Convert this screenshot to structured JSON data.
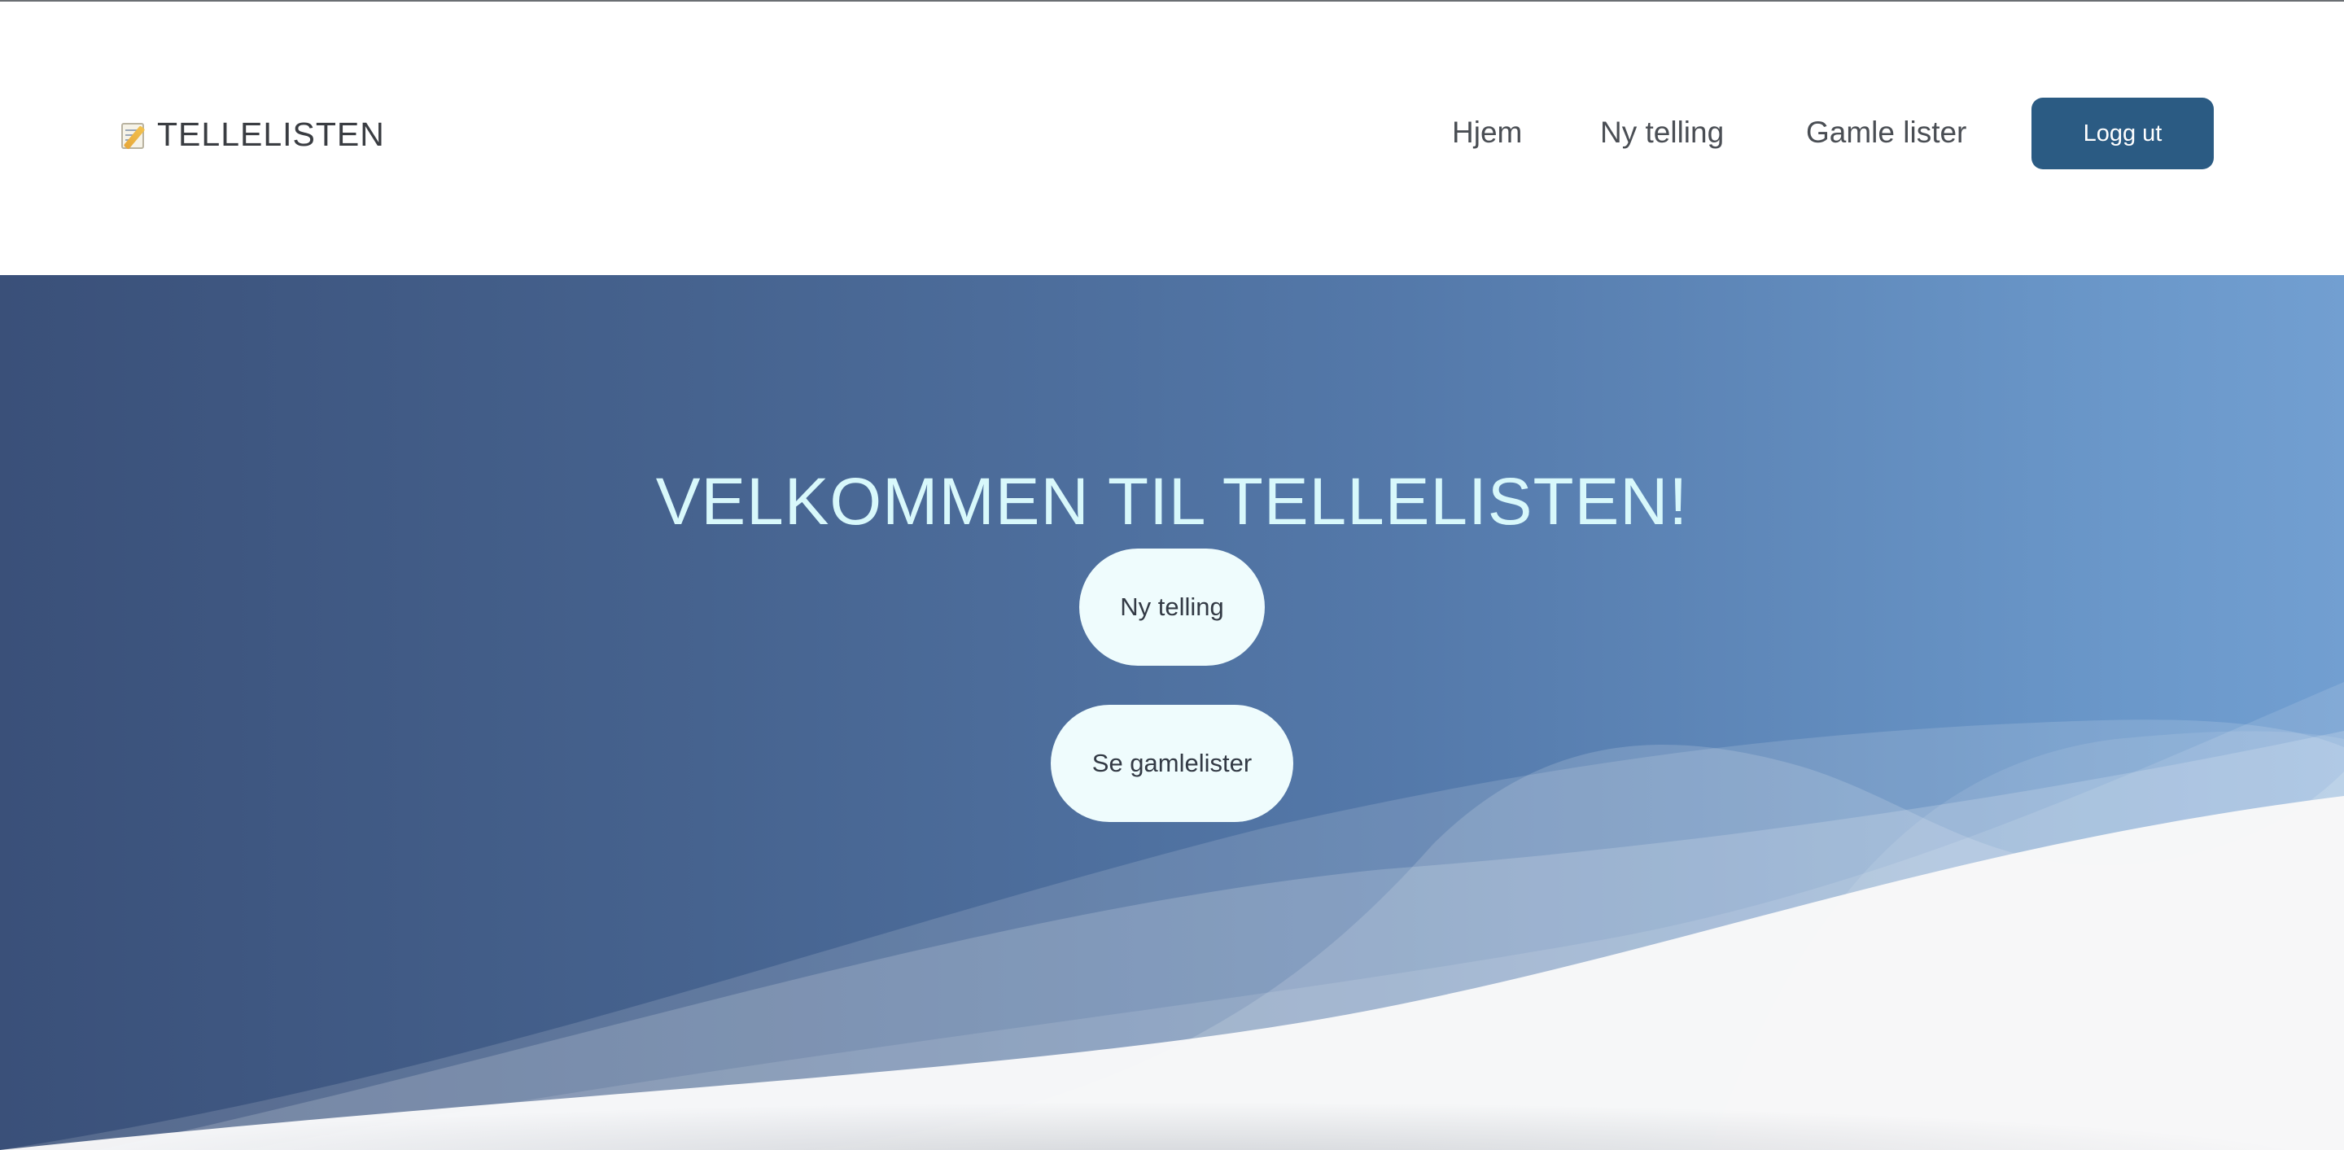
{
  "header": {
    "brand_emoji": "📝",
    "brand_text": "TELLELISTEN"
  },
  "nav": {
    "links": [
      {
        "label": "Hjem"
      },
      {
        "label": "Ny telling"
      },
      {
        "label": "Gamle lister"
      }
    ],
    "logout_label": "Logg ut"
  },
  "hero": {
    "title": "VELKOMMEN TIL TELLELISTEN!",
    "primary_button_label": "Ny telling",
    "secondary_button_label": "Se gamlelister"
  },
  "colors": {
    "logout_button": "#2b5b83",
    "hero_gradient_start": "#3a5079",
    "hero_gradient_end": "#729fd1",
    "hero_title": "#d8f8fb",
    "pill_button": "#effcfd",
    "wave_floor": "#f1f2f4"
  }
}
